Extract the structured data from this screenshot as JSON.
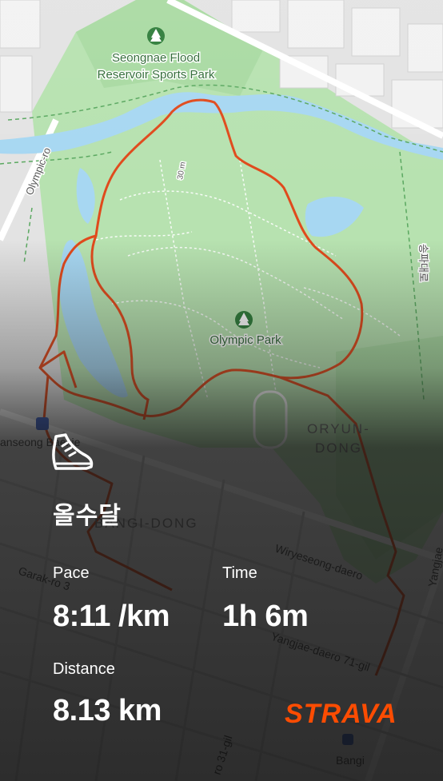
{
  "map": {
    "park_label_1": "Seongnae Flood",
    "park_label_2": "Reservoir Sports Park",
    "olympic_park": "Olympic Park",
    "olympic_ro": "Olympic-ro",
    "oryun_1": "ORYUN-",
    "oryun_2": "DONG",
    "bangi_dong": "BANGI-DONG",
    "wiryeseong": "Wiryeseong-daero",
    "garak": "Garak-ro 3",
    "yangjae": "Yangjae-daero 71-gil",
    "hanseong": "anseong Baekje",
    "bangi": "Bangi",
    "road_31": "ro 31-gil",
    "yangjae_right": "Yangjae",
    "korean_right": "송파대로",
    "contour": "30 m",
    "station_icon": "metro-station-icon",
    "park_icon": "tree-icon"
  },
  "activity": {
    "icon": "running-shoe-icon",
    "title": "올수달",
    "pace_label": "Pace",
    "pace_value": "8:11 /km",
    "time_label": "Time",
    "time_value": "1h 6m",
    "distance_label": "Distance",
    "distance_value": "8.13 km",
    "brand": "STRAVA"
  },
  "colors": {
    "route": "#e04a1c",
    "park_green": "#b8e3b0",
    "water": "#a7d7f2",
    "strava": "#fc4c02"
  }
}
